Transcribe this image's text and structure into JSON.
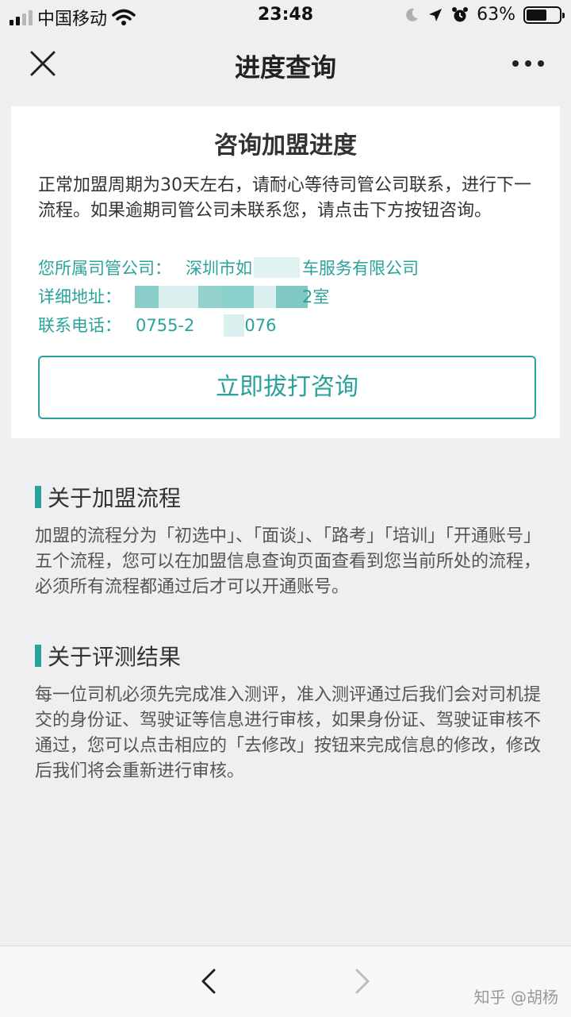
{
  "status_bar": {
    "carrier": "中国移动",
    "time": "23:48",
    "battery": "63%",
    "battery_level": 0.63
  },
  "nav": {
    "title": "进度查询"
  },
  "card": {
    "title": "咨询加盟进度",
    "description": "正常加盟周期为30天左右，请耐心等待司管公司联系，进行下一流程。如果逾期司管公司未联系您，请点击下方按钮咨询。",
    "company_label": "您所属司管公司：",
    "company_value": "深圳市如　　　车服务有限公司",
    "address_label": "详细地址：",
    "address_value": "　　　　　　　　　　2室",
    "phone_label": "联系电话：",
    "phone_value": "0755-2　　　076",
    "call_button": "立即拔打咨询"
  },
  "sections": [
    {
      "title": "关于加盟流程",
      "body": "加盟的流程分为「初选中」、「面谈」、「路考」「培训」「开通账号」五个流程，您可以在加盟信息查询页面查看到您当前所处的流程，必须所有流程都通过后才可以开通账号。"
    },
    {
      "title": "关于评测结果",
      "body": "每一位司机必须先完成准入测评，准入测评通过后我们会对司机提交的身份证、驾驶证等信息进行审核，如果身份证、驾驶证审核不通过，您可以点击相应的「去修改」按钮来完成信息的修改，修改后我们将会重新进行审核。"
    }
  ],
  "bottom": {
    "watermark": "知乎 @胡杨"
  },
  "colors": {
    "accent": "#2aa39b",
    "background": "#efeff1",
    "card": "#ffffff"
  }
}
